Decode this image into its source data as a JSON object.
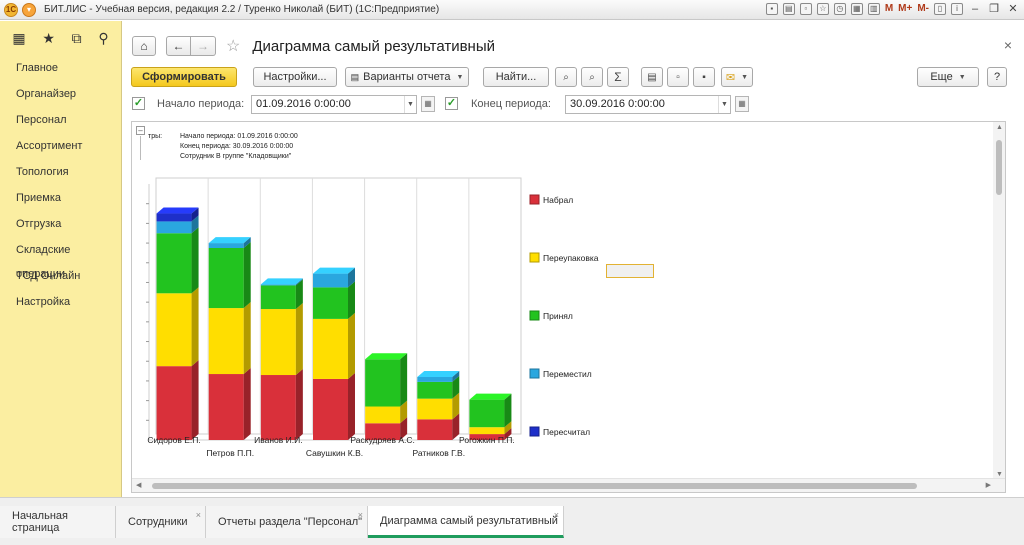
{
  "window": {
    "title": "БИТ.ЛИС - Учебная версия, редакция 2.2 / Туренко Николай (БИТ)  (1С:Предприятие)",
    "logo_text": "1С",
    "toolbar_m": [
      "M",
      "M+",
      "M-"
    ]
  },
  "sidebar": {
    "items": [
      "Главное",
      "Органайзер",
      "Персонал",
      "Ассортимент",
      "Топология",
      "Приемка",
      "Отгрузка",
      "Складские операции",
      "ТСД Онлайн",
      "Настройка"
    ]
  },
  "header": {
    "title": "Диаграмма самый результативный",
    "close": "×"
  },
  "toolbar": {
    "generate": "Сформировать",
    "settings": "Настройки...",
    "variants": "Варианты отчета",
    "find": "Найти...",
    "sum_icon": "Σ",
    "more": "Еще",
    "help": "?"
  },
  "period": {
    "start_label": "Начало периода:",
    "start_value": "01.09.2016  0:00:00",
    "end_label": "Конец периода:",
    "end_value": "30.09.2016  0:00:00"
  },
  "report": {
    "settings_key": "тры:",
    "settings_lines": [
      "Начало периода: 01.09.2016 0:00:00",
      "Конец периода: 30.09.2016 0:00:00",
      "Сотрудник В группе \"Кладовщики\""
    ]
  },
  "chart_data": {
    "type": "bar",
    "stacked": true,
    "categories": [
      "Сидоров Е.П.",
      "Петров П.П.",
      "Иванов И.И.",
      "Савушкин К.В.",
      "Раскудряев А.С.",
      "Ратников Г.В.",
      "Рогожкин П.П."
    ],
    "series": [
      {
        "name": "Набрал",
        "color": "#d9303a",
        "values": [
          75,
          67,
          66,
          62,
          17,
          21,
          6
        ]
      },
      {
        "name": "Переупаковка",
        "color": "#ffde00",
        "values": [
          74,
          67,
          67,
          61,
          17,
          21,
          7
        ]
      },
      {
        "name": "Принял",
        "color": "#22c31f",
        "values": [
          61,
          61,
          24,
          32,
          48,
          17,
          28
        ]
      },
      {
        "name": "Переместил",
        "color": "#2aa7df",
        "values": [
          12,
          5,
          1,
          14,
          0,
          5,
          0
        ]
      },
      {
        "name": "Пересчитал",
        "color": "#1e2fc9",
        "values": [
          8,
          0,
          0,
          0,
          0,
          0,
          0
        ]
      }
    ],
    "ylim": [
      0,
      260
    ],
    "grid": true,
    "legend": "right"
  },
  "tabs": [
    {
      "label": "Начальная страница",
      "closable": false,
      "active": false
    },
    {
      "label": "Сотрудники",
      "closable": true,
      "active": false
    },
    {
      "label": "Отчеты раздела \"Персонал\"",
      "closable": true,
      "active": false
    },
    {
      "label": "Диаграмма самый результативный",
      "closable": true,
      "active": true
    }
  ]
}
